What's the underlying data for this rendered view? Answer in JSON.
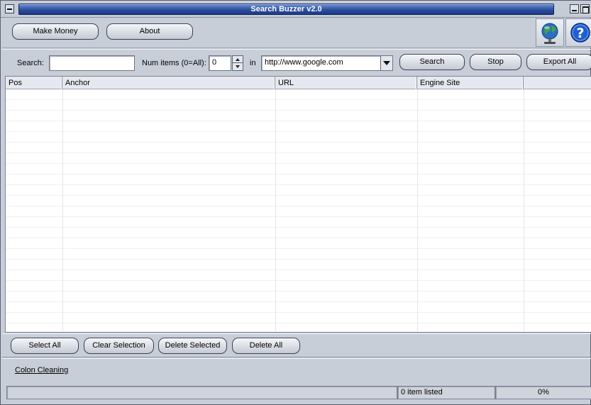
{
  "window": {
    "title": "Search Buzzer v2.0"
  },
  "toolbar": {
    "make_money_label": "Make Money",
    "about_label": "About",
    "icons": [
      "globe-icon",
      "help-icon"
    ]
  },
  "search": {
    "search_label": "Search:",
    "search_value": "",
    "num_items_label": "Num items (0=All):",
    "num_items_value": "0",
    "in_label": "in",
    "engine_value": "http://www.google.com",
    "search_button": "Search",
    "stop_button": "Stop",
    "export_button": "Export All"
  },
  "table": {
    "columns": [
      "Pos",
      "Anchor",
      "URL",
      "Engine Site",
      ""
    ],
    "rows": []
  },
  "actions": {
    "select_all": "Select All",
    "clear_selection": "Clear Selection",
    "delete_selected": "Delete Selected",
    "delete_all": "Delete All"
  },
  "footer": {
    "link_label": "Colon Cleaning"
  },
  "status": {
    "message": "",
    "count_text": "0 item listed",
    "progress_text": "0%"
  },
  "colors": {
    "title_bar": "#2d4f9f",
    "window_bg": "#c8ced8"
  }
}
